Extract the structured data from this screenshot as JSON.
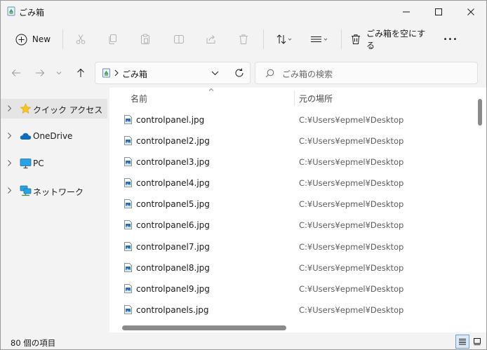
{
  "window": {
    "title": "ごみ箱",
    "title_icon": "recycle-bin-icon",
    "controls": [
      "minimize-icon",
      "maximize-icon",
      "close-icon"
    ]
  },
  "toolbar": {
    "new_label": "New",
    "empty_bin_label": "ごみ箱を空にする",
    "more_label": "•••",
    "icons": [
      "cut-icon",
      "copy-icon",
      "paste-icon",
      "rename-icon",
      "share-icon",
      "delete-icon",
      "sort-icon",
      "view-icon"
    ]
  },
  "address": {
    "path_label": "ごみ箱",
    "search_placeholder": "ごみ箱の検索"
  },
  "sidebar": {
    "items": [
      {
        "label": "クイック アクセス",
        "icon": "star-icon",
        "selected": true
      },
      {
        "label": "OneDrive",
        "icon": "cloud-icon",
        "selected": false
      },
      {
        "label": "PC",
        "icon": "monitor-icon",
        "selected": false
      },
      {
        "label": "ネットワーク",
        "icon": "network-icon",
        "selected": false
      }
    ]
  },
  "table": {
    "columns": [
      "名前",
      "元の場所"
    ],
    "rows": [
      {
        "name": "controlpanel.jpg",
        "location": "C:¥Users¥epmel¥Desktop"
      },
      {
        "name": "controlpanel2.jpg",
        "location": "C:¥Users¥epmel¥Desktop"
      },
      {
        "name": "controlpanel3.jpg",
        "location": "C:¥Users¥epmel¥Desktop"
      },
      {
        "name": "controlpanel4.jpg",
        "location": "C:¥Users¥epmel¥Desktop"
      },
      {
        "name": "controlpanel5.jpg",
        "location": "C:¥Users¥epmel¥Desktop"
      },
      {
        "name": "controlpanel6.jpg",
        "location": "C:¥Users¥epmel¥Desktop"
      },
      {
        "name": "controlpanel7.jpg",
        "location": "C:¥Users¥epmel¥Desktop"
      },
      {
        "name": "controlpanel8.jpg",
        "location": "C:¥Users¥epmel¥Desktop"
      },
      {
        "name": "controlpanel9.jpg",
        "location": "C:¥Users¥epmel¥Desktop"
      },
      {
        "name": "controlpanels.jpg",
        "location": "C:¥Users¥epmel¥Desktop"
      }
    ]
  },
  "status": {
    "item_count": "80 個の項目"
  },
  "colors": {
    "accent": "#0067c0",
    "selected_bg": "#e5e5e5",
    "window_bg": "#f3f3f3"
  }
}
